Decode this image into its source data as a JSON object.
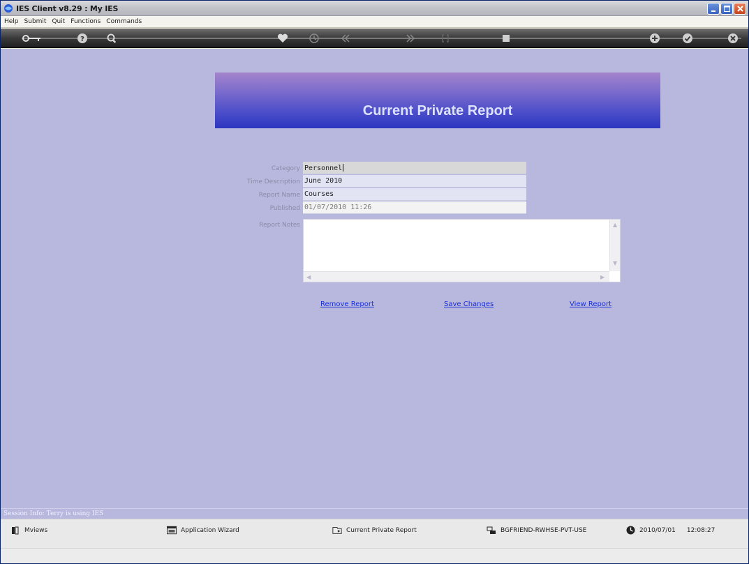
{
  "window": {
    "title": "IES Client v8.29 : My IES"
  },
  "menu": [
    "Help",
    "Submit",
    "Quit",
    "Functions",
    "Commands"
  ],
  "toolbar": {
    "icons": [
      "key-icon",
      "help-icon",
      "search-icon",
      "heart-icon",
      "clock-icon",
      "rewind-icon",
      "fast-forward-icon",
      "bracket-icon",
      "stop-icon",
      "add-icon",
      "check-icon",
      "close-icon"
    ]
  },
  "banner": {
    "title": "Current Private Report"
  },
  "form": {
    "category_label": "Category",
    "category_value": "Personnel",
    "time_label": "Time Description",
    "time_value": "June 2010",
    "report_name_label": "Report Name",
    "report_name_value": "Courses",
    "published_label": "Published",
    "published_value": "01/07/2010 11:26",
    "notes_label": "Report Notes",
    "notes_value": ""
  },
  "actions": {
    "remove": "Remove Report",
    "save": "Save Changes",
    "view": "View Report"
  },
  "status": {
    "session": "Session Info: Terry is using IES"
  },
  "taskbar": {
    "mviews": "Mviews",
    "wizard": "Application Wizard",
    "current": "Current Private Report",
    "user": "BGFRIEND-RWHSE-PVT-USE",
    "date": "2010/07/01",
    "time": "12:08:27"
  }
}
